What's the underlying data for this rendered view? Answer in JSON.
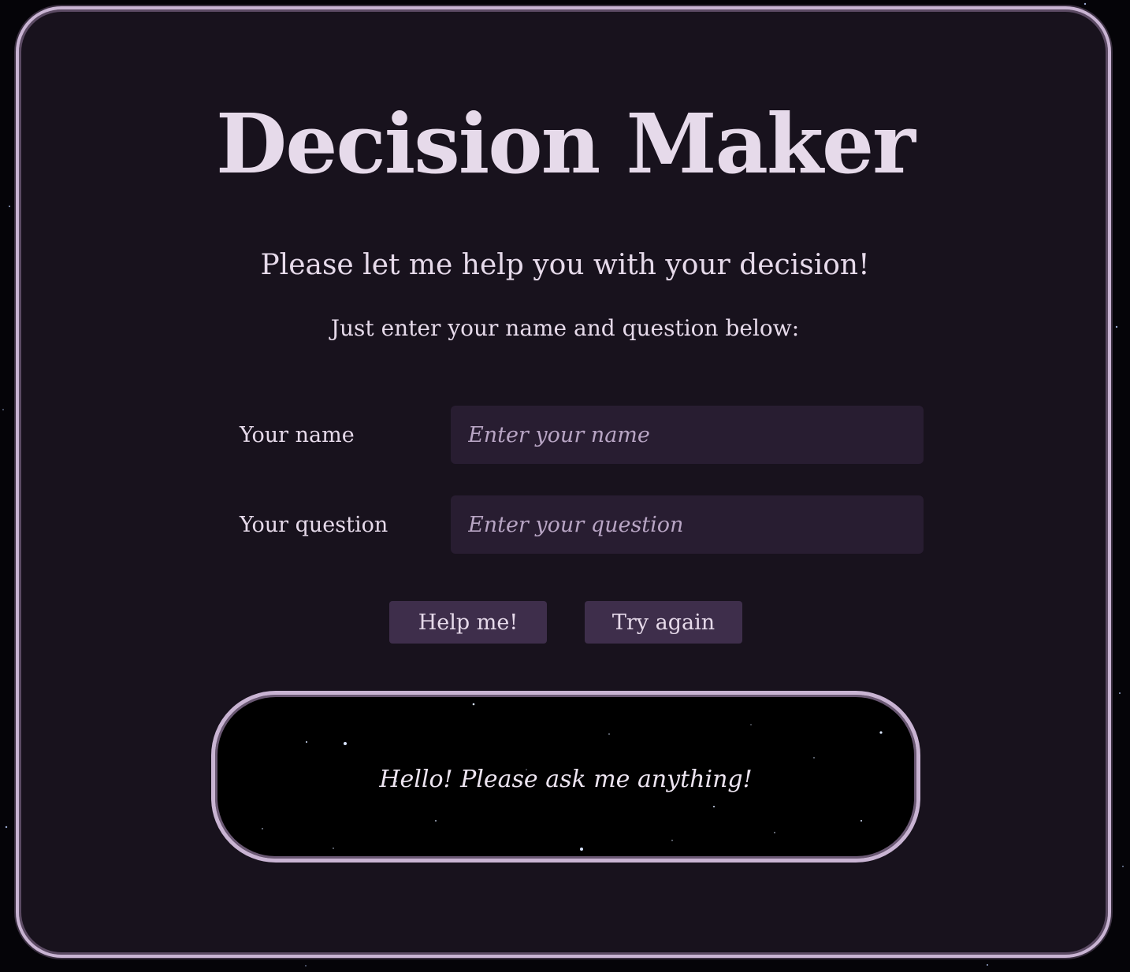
{
  "header": {
    "title": "Decision Maker",
    "subtitle": "Please let me help you with your decision!",
    "instruction": "Just enter your name and question below:"
  },
  "form": {
    "name_label": "Your name",
    "name_placeholder": "Enter your name",
    "name_value": "",
    "question_label": "Your question",
    "question_placeholder": "Enter your question",
    "question_value": ""
  },
  "actions": {
    "help_label": "Help me!",
    "retry_label": "Try again"
  },
  "answer": {
    "message": "Hello! Please ask me anything!"
  },
  "colors": {
    "background": "#050408",
    "card": "#18121d",
    "border": "#c9b4d3",
    "text": "#e6daea",
    "input": "#281d31",
    "button": "#3e2e4b"
  }
}
